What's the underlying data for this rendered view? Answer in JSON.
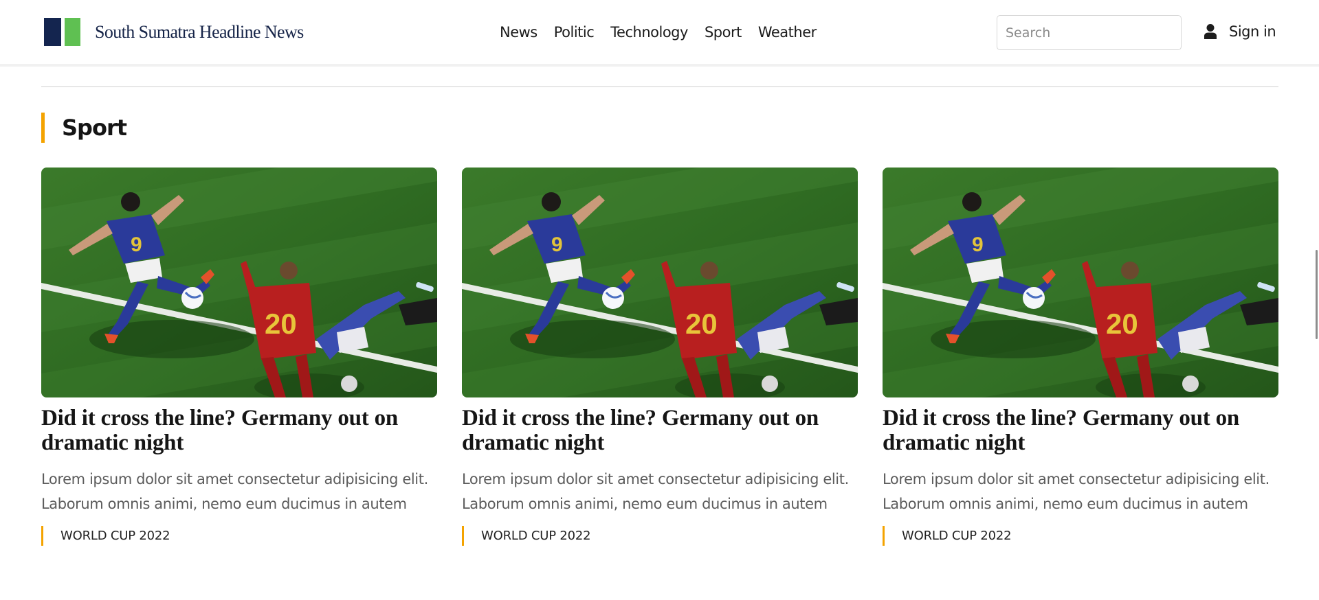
{
  "header": {
    "brand": "South Sumatra Headline News",
    "nav": [
      "News",
      "Politic",
      "Technology",
      "Sport",
      "Weather"
    ],
    "search_placeholder": "Search",
    "signin_label": "Sign in"
  },
  "section": {
    "title": "Sport"
  },
  "cards": [
    {
      "title": "Did it cross the line? Germany out on dramatic night",
      "excerpt": "Lorem ipsum dolor sit amet consectetur adipisicing elit. Laborum omnis animi, nemo eum ducimus in autem",
      "tag": "WORLD CUP 2022"
    },
    {
      "title": "Did it cross the line? Germany out on dramatic night",
      "excerpt": "Lorem ipsum dolor sit amet consectetur adipisicing elit. Laborum omnis animi, nemo eum ducimus in autem",
      "tag": "WORLD CUP 2022"
    },
    {
      "title": "Did it cross the line? Germany out on dramatic night",
      "excerpt": "Lorem ipsum dolor sit amet consectetur adipisicing elit. Laborum omnis animi, nemo eum ducimus in autem",
      "tag": "WORLD CUP 2022"
    }
  ],
  "colors": {
    "brand_navy": "#14254f",
    "brand_green": "#5fc052",
    "accent": "#f4a300"
  },
  "icons": {
    "logo": "logo-mark",
    "user": "user-icon"
  }
}
